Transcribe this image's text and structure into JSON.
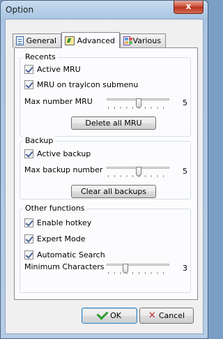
{
  "window": {
    "title": "Option",
    "close_glyph": "x"
  },
  "tabs": [
    {
      "label": "General",
      "icon": "general-tab-icon"
    },
    {
      "label": "Advanced",
      "icon": "advanced-tab-icon"
    },
    {
      "label": "Various",
      "icon": "various-tab-icon"
    }
  ],
  "recents": {
    "title": "Recents",
    "active_mru": {
      "label": "Active MRU",
      "checked": true
    },
    "mru_submenu": {
      "label": "MRU on trayicon submenu",
      "checked": true
    },
    "max_mru": {
      "label": "Max number MRU",
      "value": "5",
      "level": 0.5
    },
    "delete_button": "Delete all MRU"
  },
  "backup": {
    "title": "Backup",
    "active_backup": {
      "label": "Active backup",
      "checked": true
    },
    "max_backup": {
      "label": "Max backup number",
      "value": "5",
      "level": 0.5
    },
    "clear_button": "Clear all backups"
  },
  "other": {
    "title": "Other functions",
    "hotkey": {
      "label": "Enable hotkey",
      "checked": true
    },
    "expert": {
      "label": "Expert Mode",
      "checked": true
    },
    "auto_search": {
      "label": "Automatic Search",
      "checked": true
    },
    "min_chars": {
      "label": "Minimum Characters",
      "value": "3",
      "level": 0.3
    }
  },
  "footer": {
    "ok_label": "OK",
    "cancel_label": "Cancel"
  }
}
